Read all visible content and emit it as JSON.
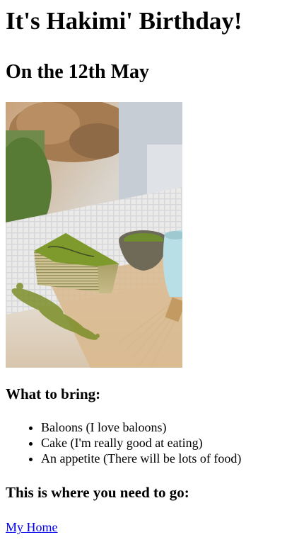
{
  "page": {
    "title": "It's Hakimi' Birthday!",
    "date": "On the 12th May"
  },
  "bring": {
    "heading": "What to bring:",
    "items": [
      "Baloons (I love baloons)",
      "Cake (I'm really good at eating)",
      "An appetite (There will be lots of food)"
    ]
  },
  "directions": {
    "heading": "This is where you need to go:",
    "link_label": "My Home"
  },
  "colors": {
    "link": "#0000ee",
    "text": "#000000",
    "background": "#ffffff"
  }
}
